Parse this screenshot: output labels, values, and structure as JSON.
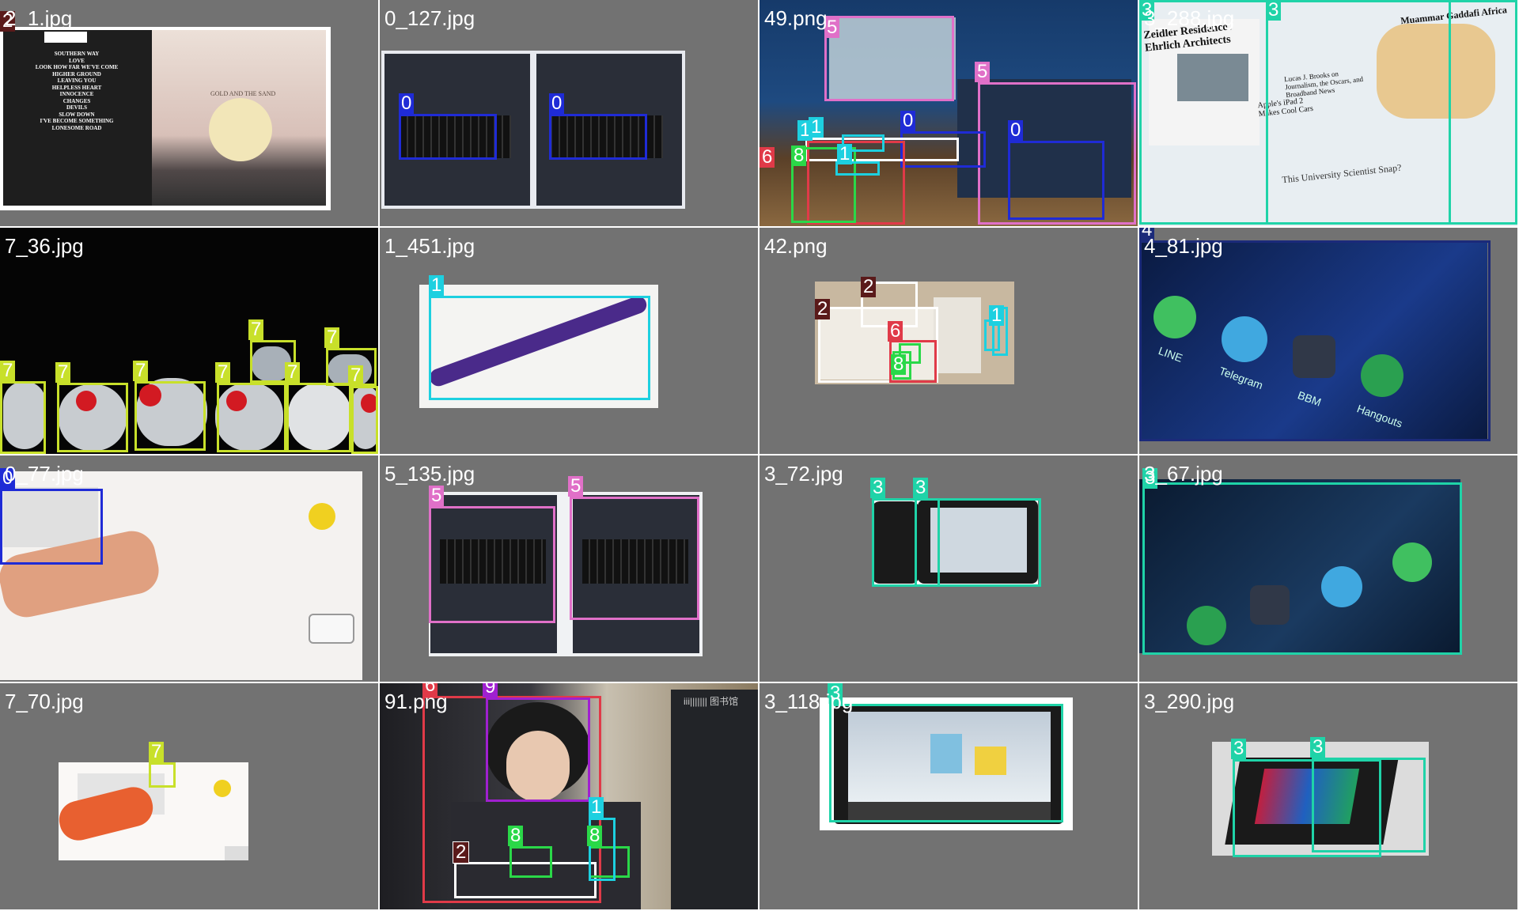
{
  "mosaic": {
    "tiles": [
      {
        "name": "2_1.jpg"
      },
      {
        "name": "0_127.jpg"
      },
      {
        "name": "49.png"
      },
      {
        "name": "3_288.jpg"
      },
      {
        "name": "7_36.jpg"
      },
      {
        "name": "1_451.jpg"
      },
      {
        "name": "42.png"
      },
      {
        "name": "4_81.jpg"
      },
      {
        "name": "0_77.jpg"
      },
      {
        "name": "5_135.jpg"
      },
      {
        "name": "3_72.jpg"
      },
      {
        "name": "3_67.jpg"
      },
      {
        "name": "7_70.jpg"
      },
      {
        "name": "91.png"
      },
      {
        "name": "3_118.jpg"
      },
      {
        "name": "3_290.jpg"
      }
    ],
    "album": {
      "title": "GOLD AND THE SAND",
      "tracks": [
        "SOUTHERN WAY",
        "LOVE",
        "LOOK HOW FAR WE'VE COME",
        "HIGHER GROUND",
        "LEAVING YOU",
        "HELPLESS HEART",
        "INNOCENCE",
        "CHANGES",
        "DEVILS",
        "SLOW DOWN",
        "I'VE BECOME SOMETHING",
        "LONESOME ROAD"
      ]
    },
    "newspaper": {
      "headline_left": "Zeidler Residence / Ehrlich Architects",
      "headline_right": "Muammar Gaddafi Africa",
      "story_1": "Apple's iPad 2 Makes Cool Cars",
      "story_2": "Lucas J. Brooks on Journalism, the Oscars, and Broadband News",
      "story_3": "This University Scientist Snap?"
    },
    "phone_apps": [
      "LINE",
      "Telegram",
      "BBM",
      "Hangouts"
    ],
    "library_sign": "iii||||||| 图书馆"
  },
  "classes": {
    "0": "#1f2bd6",
    "1": "#1dd0e0",
    "2": "#5a1a1a",
    "3": "#1fd3a8",
    "4": "#1b2a7a",
    "5": "#e070c8",
    "6": "#e03a48",
    "7": "#c8e02a",
    "8": "#2ad848",
    "9": "#a020d0"
  }
}
